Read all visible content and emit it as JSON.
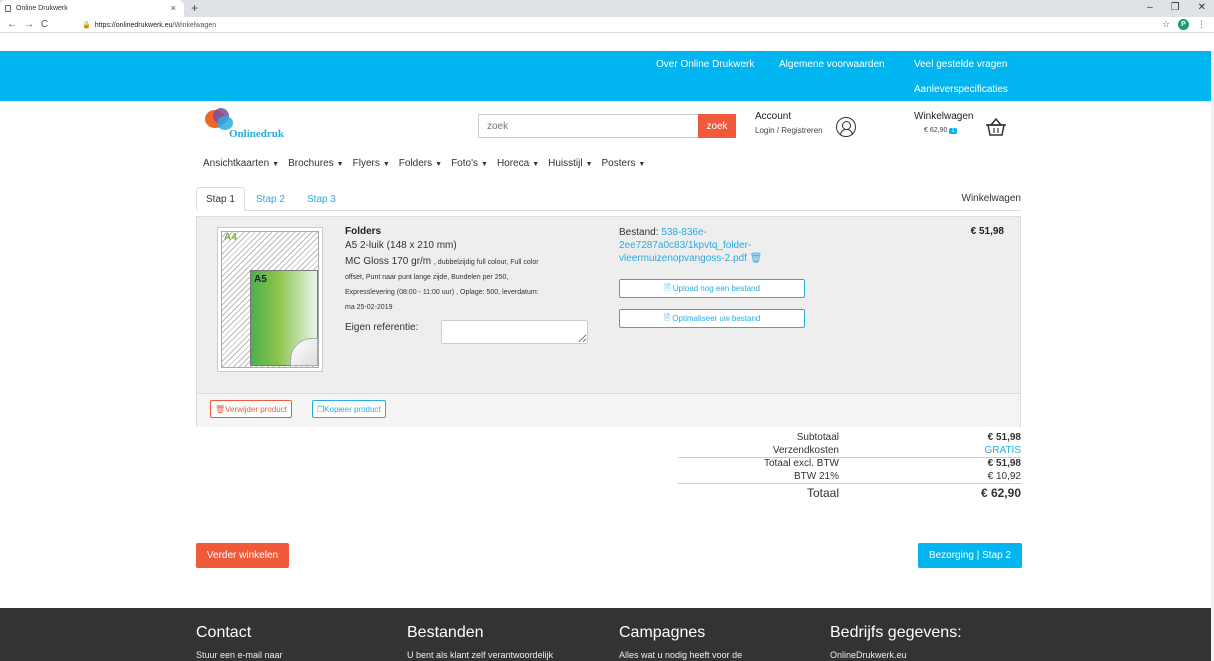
{
  "browser": {
    "tab_title": "Online Drukwerk",
    "tab_close": "×",
    "new_tab": "+",
    "url_domain": "https://onlinedrukwerk.eu",
    "url_path": "/Winkelwagen",
    "profile_initial": "P"
  },
  "topnav": {
    "links": [
      "Over Online Drukwerk",
      "Algemene voorwaarden",
      "Veel gestelde vragen",
      "Aanleverspecificaties"
    ]
  },
  "header": {
    "logo_text": "Onlinedruk",
    "search_placeholder": "zoek",
    "search_button": "zoek",
    "account_title": "Account",
    "account_sub": "Login / Registreren",
    "cart_title": "Winkelwagen",
    "cart_amount": "€ 62,90",
    "cart_count": "1"
  },
  "menu": [
    "Ansichtkaarten",
    "Brochures",
    "Flyers",
    "Folders",
    "Foto's",
    "Horeca",
    "Huisstijl",
    "Posters"
  ],
  "steps": {
    "tabs": [
      "Stap 1",
      "Stap 2",
      "Stap 3"
    ],
    "right_label": "Winkelwagen"
  },
  "product": {
    "a4_label": "A4",
    "a5_label": "A5",
    "name": "Folders",
    "format": "A5 2-luik (148 x 210 mm)",
    "paper": "MC Gloss 170 gr/m",
    "paper_detail": ", dubbelzijdig full colour, Full color",
    "desc_lines": [
      "offset, Punt naar punt lange zijde, Bundelen per 250,",
      "Expresslevering (08:00 - 11:00 uur) , Oplage: 500, leverdatum:",
      "ma 25-02-2019"
    ],
    "ref_label": "Eigen referentie:",
    "file_label": "Bestand: ",
    "file_name": "538-836e-2ee7287a0c83/1kpvtq_folder-vleermuizenopvangoss-2.pdf",
    "upload_button": "Upload nog een bestand",
    "optimize_button": "Optimaliseer uw bestand",
    "price": "€ 51,98",
    "remove_button": "Verwijder product",
    "copy_button": "Kopieer product"
  },
  "totals": {
    "subtotal_label": "Subtotaal",
    "subtotal": "€ 51,98",
    "shipping_label": "Verzendkosten",
    "shipping": "GRATIS",
    "excl_label": "Totaal excl. BTW",
    "excl": "€ 51,98",
    "vat_label": "BTW 21%",
    "vat": "€ 10,92",
    "total_label": "Totaal",
    "total": "€ 62,90"
  },
  "actions": {
    "continue": "Verder winkelen",
    "next": "Bezorging | Stap 2"
  },
  "footer": {
    "cols": [
      {
        "heading": "Contact",
        "text": "Stuur een e-mail naar"
      },
      {
        "heading": "Bestanden",
        "text": "U bent als klant zelf verantwoordelijk"
      },
      {
        "heading": "Campagnes",
        "text": "Alles wat u nodig heeft voor de"
      },
      {
        "heading": "Bedrijfs gegevens:",
        "text": "OnlineDrukwerk.eu"
      }
    ]
  },
  "colors": {
    "accent": "#00b5f0",
    "danger": "#f05a3b",
    "footer": "#333333"
  }
}
